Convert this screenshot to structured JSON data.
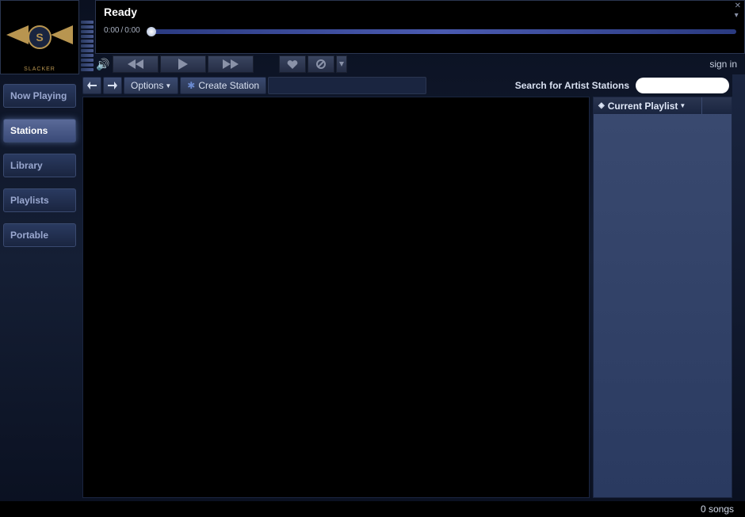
{
  "app": {
    "brand": "SLACKER",
    "monogram": "S"
  },
  "player": {
    "status": "Ready",
    "time_elapsed": "0:00",
    "time_total": "0:00"
  },
  "auth": {
    "signin_label": "sign in"
  },
  "sidebar": {
    "items": [
      {
        "label": "Now Playing",
        "active": false
      },
      {
        "label": "Stations",
        "active": true
      },
      {
        "label": "Library",
        "active": false
      },
      {
        "label": "Playlists",
        "active": false
      },
      {
        "label": "Portable",
        "active": false
      }
    ]
  },
  "toolbar": {
    "options_label": "Options",
    "create_station_label": "Create Station",
    "search_label": "Search for Artist Stations",
    "search_value": ""
  },
  "playlist": {
    "header": "Current Playlist"
  },
  "footer": {
    "song_count": "0 songs"
  }
}
